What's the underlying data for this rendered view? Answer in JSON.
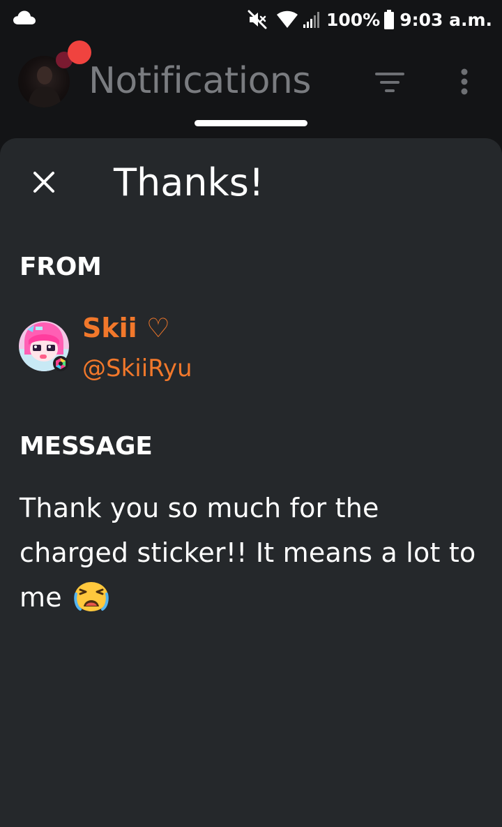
{
  "status_bar": {
    "battery": "100%",
    "time": "9:03 a.m.",
    "icons": [
      "cloud-icon",
      "mute-icon",
      "wifi-icon",
      "signal-icon",
      "battery-icon"
    ]
  },
  "header": {
    "title": "Notifications",
    "icons": [
      "filter-icon",
      "more-vert-icon"
    ],
    "notification_dot_color": "#f0433f"
  },
  "sheet": {
    "title": "Thanks!",
    "close_icon": "close-icon",
    "from_label": "FROM",
    "sender": {
      "name": "Skii ♡",
      "handle": "@SkiiRyu",
      "name_color": "#f2782b"
    },
    "message_label": "MESSAGE",
    "message_text": "Thank you so much for the charged sticker!! It means a lot to me",
    "message_emoji": "crying-face-emoji"
  },
  "colors": {
    "background": "#131416",
    "sheet": "#25282b",
    "accent_orange": "#f2782b",
    "header_title": "#7a7c80"
  }
}
